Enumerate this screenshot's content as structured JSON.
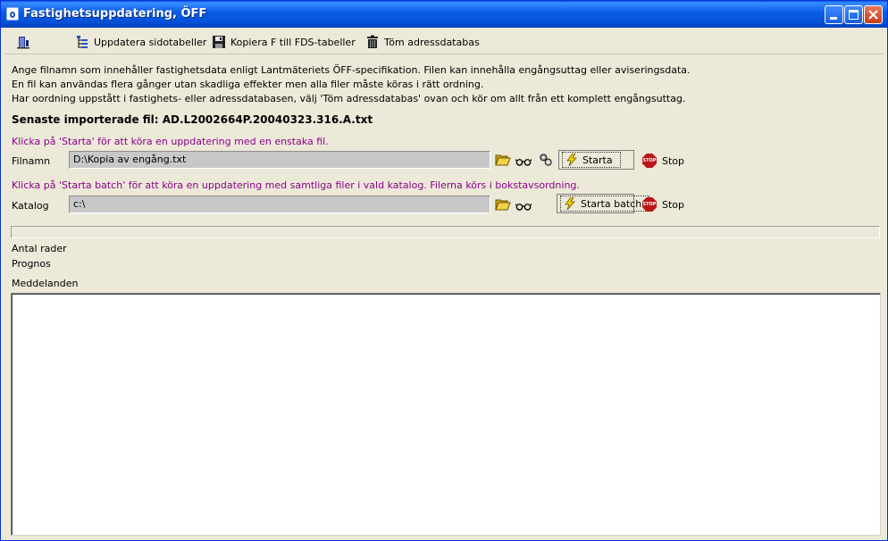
{
  "window": {
    "title": "Fastighetsuppdatering, ÖFF"
  },
  "toolbar": {
    "update_side_tables": "Uppdatera sidotabeller",
    "copy_f_to_fds": "Kopiera F till FDS-tabeller",
    "empty_address_db": "Töm adressdatabas"
  },
  "info": {
    "line1": "Ange filnamn som innehåller fastighetsdata enligt Lantmäteriets ÖFF-specifikation. Filen kan innehålla engångsuttag eller aviseringsdata.",
    "line2": "En fil kan användas flera gånger utan skadliga effekter men alla filer måste köras i rätt ordning.",
    "line3": "Har oordning uppstått i fastighets- eller adressdatabasen, välj 'Töm adressdatabas' ovan och kör om allt från ett komplett engångsuttag.",
    "last_imported": "Senaste importerade fil: AD.L2002664P.20040323.316.A.txt"
  },
  "single": {
    "hint": "Klicka på 'Starta' för att köra en uppdatering med en enstaka fil.",
    "label": "Filnamn",
    "value": "D:\\Kopia av engång.txt",
    "start_label": "Starta",
    "stop_label": "Stop"
  },
  "batch": {
    "hint": "Klicka på 'Starta batch' för att köra en uppdatering med samtliga filer i vald katalog. Filerna körs i bokstavsordning.",
    "label": "Katalog",
    "value": "c:\\",
    "start_label": "Starta batch",
    "stop_label": "Stop"
  },
  "status": {
    "rows_label": "Antal rader",
    "forecast_label": "Prognos",
    "messages_label": "Meddelanden",
    "progress": 0
  },
  "colors": {
    "hint": "#8b008b",
    "titlebar": "#0a5fe6",
    "face": "#ece9d8"
  }
}
